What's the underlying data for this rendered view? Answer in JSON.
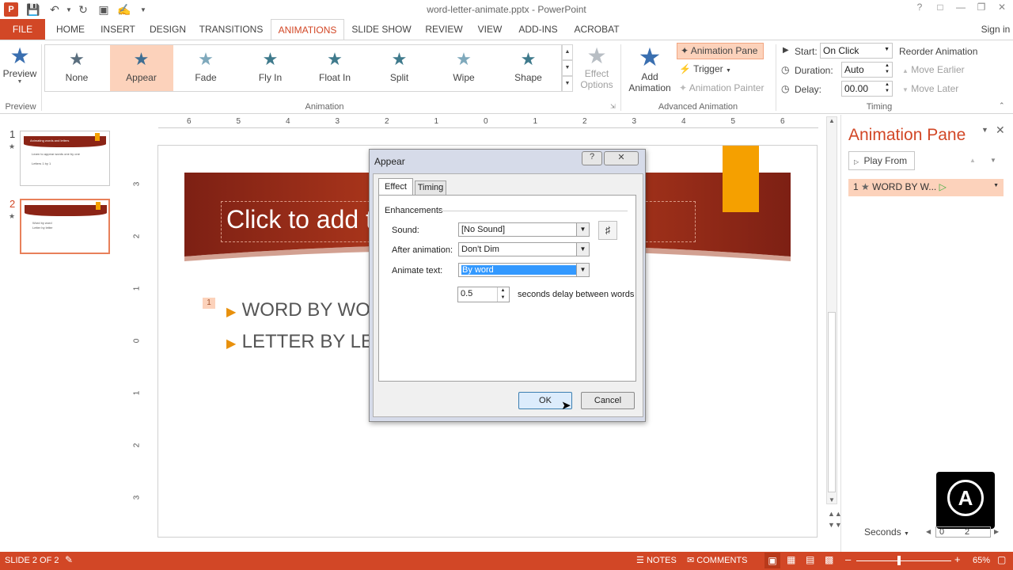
{
  "window": {
    "title": "word-letter-animate.pptx - PowerPoint",
    "signin": "Sign in",
    "help": "?"
  },
  "tabs": [
    "FILE",
    "HOME",
    "INSERT",
    "DESIGN",
    "TRANSITIONS",
    "ANIMATIONS",
    "SLIDE SHOW",
    "REVIEW",
    "VIEW",
    "ADD-INS",
    "ACROBAT"
  ],
  "ribbon": {
    "preview": {
      "label": "Preview",
      "group": "Preview"
    },
    "animation_group": "Animation",
    "effects": [
      "None",
      "Appear",
      "Fade",
      "Fly In",
      "Float In",
      "Split",
      "Wipe",
      "Shape"
    ],
    "selected_effect": "Appear",
    "effect_options": {
      "line1": "Effect",
      "line2": "Options"
    },
    "add_animation": {
      "line1": "Add",
      "line2": "Animation"
    },
    "animation_pane": "Animation Pane",
    "trigger": "Trigger",
    "animation_painter": "Animation Painter",
    "advanced_group": "Advanced Animation",
    "start_label": "Start:",
    "start_value": "On Click",
    "duration_label": "Duration:",
    "duration_value": "Auto",
    "delay_label": "Delay:",
    "delay_value": "00.00",
    "reorder": "Reorder Animation",
    "move_earlier": "Move Earlier",
    "move_later": "Move Later",
    "timing_group": "Timing"
  },
  "ruler": [
    "6",
    "5",
    "4",
    "3",
    "2",
    "1",
    "0",
    "1",
    "2",
    "3",
    "4",
    "5",
    "6"
  ],
  "vruler": [
    "3",
    "2",
    "1",
    "0",
    "1",
    "2",
    "3"
  ],
  "thumbnails": [
    {
      "num": "1",
      "title": "Animating words and letters",
      "lines": [
        "Learn to appear words one by one",
        "Letters 1 by 1"
      ]
    },
    {
      "num": "2",
      "title": "",
      "lines": [
        "Word by word",
        "Letter by letter"
      ]
    }
  ],
  "slide": {
    "title_placeholder": "Click to add title",
    "bullets": [
      "WORD BY WORD",
      "LETTER BY LETTER"
    ],
    "anim_tag": "1"
  },
  "dialog": {
    "title": "Appear",
    "tabs": [
      "Effect",
      "Timing"
    ],
    "section": "Enhancements",
    "sound_label": "Sound:",
    "sound_value": "[No Sound]",
    "after_label": "After animation:",
    "after_value": "Don't Dim",
    "animate_label": "Animate text:",
    "animate_value": "By word",
    "delay_value": "0.5",
    "delay_suffix": "seconds delay between words",
    "ok": "OK",
    "cancel": "Cancel"
  },
  "anim_pane": {
    "title": "Animation Pane",
    "play_from": "Play From",
    "item_num": "1",
    "item_label": "WORD BY W...",
    "seconds": "Seconds",
    "scale0": "0",
    "scale2": "2"
  },
  "status": {
    "slide": "SLIDE 2 OF 2",
    "notes": "NOTES",
    "comments": "COMMENTS",
    "zoom": "65%"
  },
  "colors": {
    "accent": "#d24726",
    "selected": "#fcd2bb",
    "slide_band": "#8b2416",
    "orange_tab": "#f5a000",
    "bullet": "#e8900c"
  }
}
